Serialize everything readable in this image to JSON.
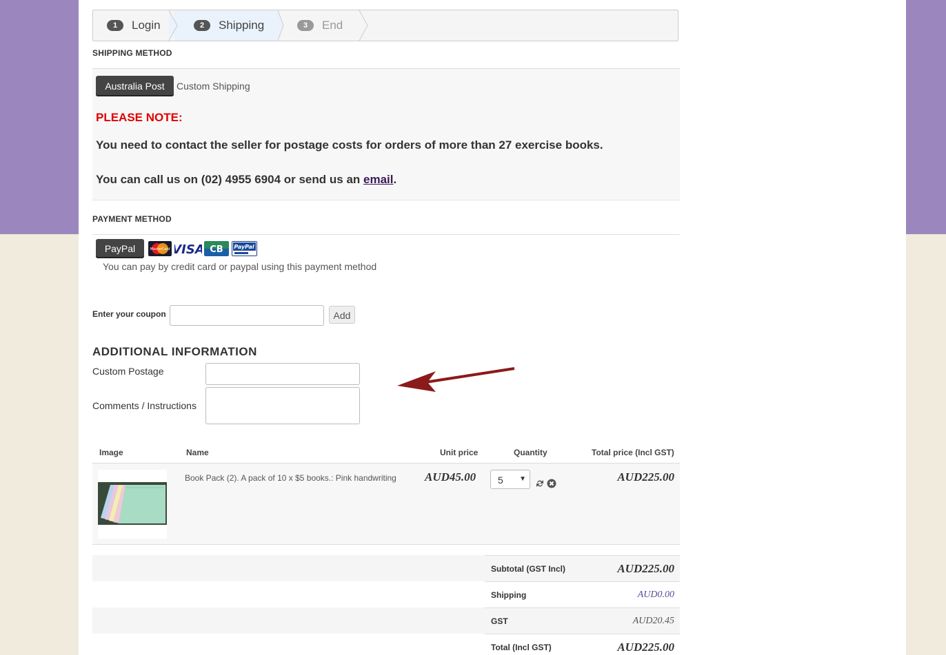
{
  "steps": [
    {
      "num": "1",
      "label": "Login"
    },
    {
      "num": "2",
      "label": "Shipping"
    },
    {
      "num": "3",
      "label": "End"
    }
  ],
  "shipping": {
    "heading": "SHIPPING METHOD",
    "options": [
      "Australia Post",
      "Custom Shipping"
    ],
    "note_title": "PLEASE NOTE:",
    "note_line1": "You need to contact the seller for postage costs for orders of more than 27 exercise books.",
    "note_line2_prefix": "You can call us on (02) 4955 6904 or send us an ",
    "note_line2_link": "email",
    "note_line2_suffix": "."
  },
  "payment": {
    "heading": "PAYMENT METHOD",
    "option": "PayPal",
    "cards": [
      "mastercard-icon",
      "visa-icon",
      "cb-icon",
      "paypal-icon"
    ],
    "card_labels": {
      "mastercard": "MasterCard",
      "visa": "VISA",
      "cb": "CB",
      "paypal": "PayPal"
    },
    "description": "You can pay by credit card or paypal using this payment method"
  },
  "coupon": {
    "label": "Enter your coupon",
    "value": "",
    "button": "Add"
  },
  "additional": {
    "heading": "ADDITIONAL INFORMATION",
    "custom_postage_label": "Custom Postage",
    "custom_postage_value": "",
    "comments_label": "Comments / Instructions",
    "comments_value": ""
  },
  "cart": {
    "headers": {
      "image": "Image",
      "name": "Name",
      "unit_price": "Unit price",
      "quantity": "Quantity",
      "total": "Total price (Incl GST)"
    },
    "items": [
      {
        "name": "Book Pack (2). A pack of 10 x $5 books.: Pink handwriting",
        "unit_price": "AUD45.00",
        "quantity": "5",
        "total": "AUD225.00"
      }
    ]
  },
  "totals": {
    "subtotal_label": "Subtotal (GST Incl)",
    "subtotal": "AUD225.00",
    "shipping_label": "Shipping",
    "shipping": "AUD0.00",
    "gst_label": "GST",
    "gst": "AUD20.45",
    "total_label": "Total (Incl GST)",
    "total": "AUD225.00"
  },
  "colors": {
    "accent_bg": "#9b87bd",
    "page_bg": "#f0ebdd",
    "note_red": "#e00000",
    "arrow": "#8b1a1a",
    "shipping_value": "#5a4a9a"
  }
}
